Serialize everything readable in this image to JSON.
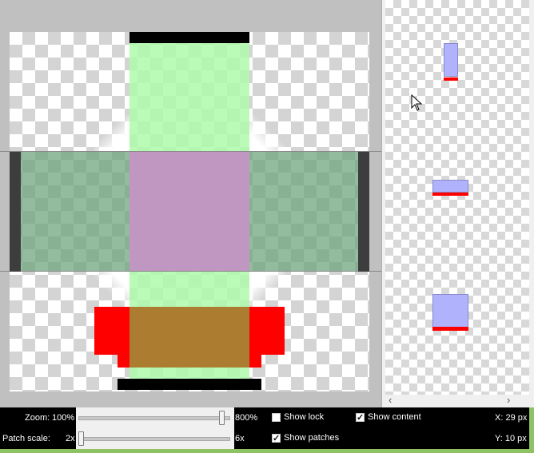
{
  "zoom": {
    "label": "Zoom:",
    "min_label": "100%",
    "max_label": "800%",
    "level": 0.95
  },
  "patch_scale": {
    "label": "Patch scale:",
    "min_label": "2x",
    "max_label": "6x",
    "level": 0.0
  },
  "options": {
    "show_lock": {
      "label": "Show lock",
      "checked": false
    },
    "show_content": {
      "label": "Show content",
      "checked": true
    },
    "show_patches": {
      "label": "Show patches",
      "checked": true
    }
  },
  "coords": {
    "x": "X: 29 px",
    "y": "Y: 10 px"
  },
  "scroll": {
    "left_arrow": "‹",
    "right_arrow": "›"
  },
  "colors": {
    "patch_green": "#aefcaa",
    "patch_dark_green": "#8abd96",
    "patch_purple": "#c097c0",
    "patch_brown": "#ac7d31",
    "marker_red": "#ff0000",
    "preview_blue": "#b0b3fb",
    "editor_bg": "#c0c0c0"
  }
}
